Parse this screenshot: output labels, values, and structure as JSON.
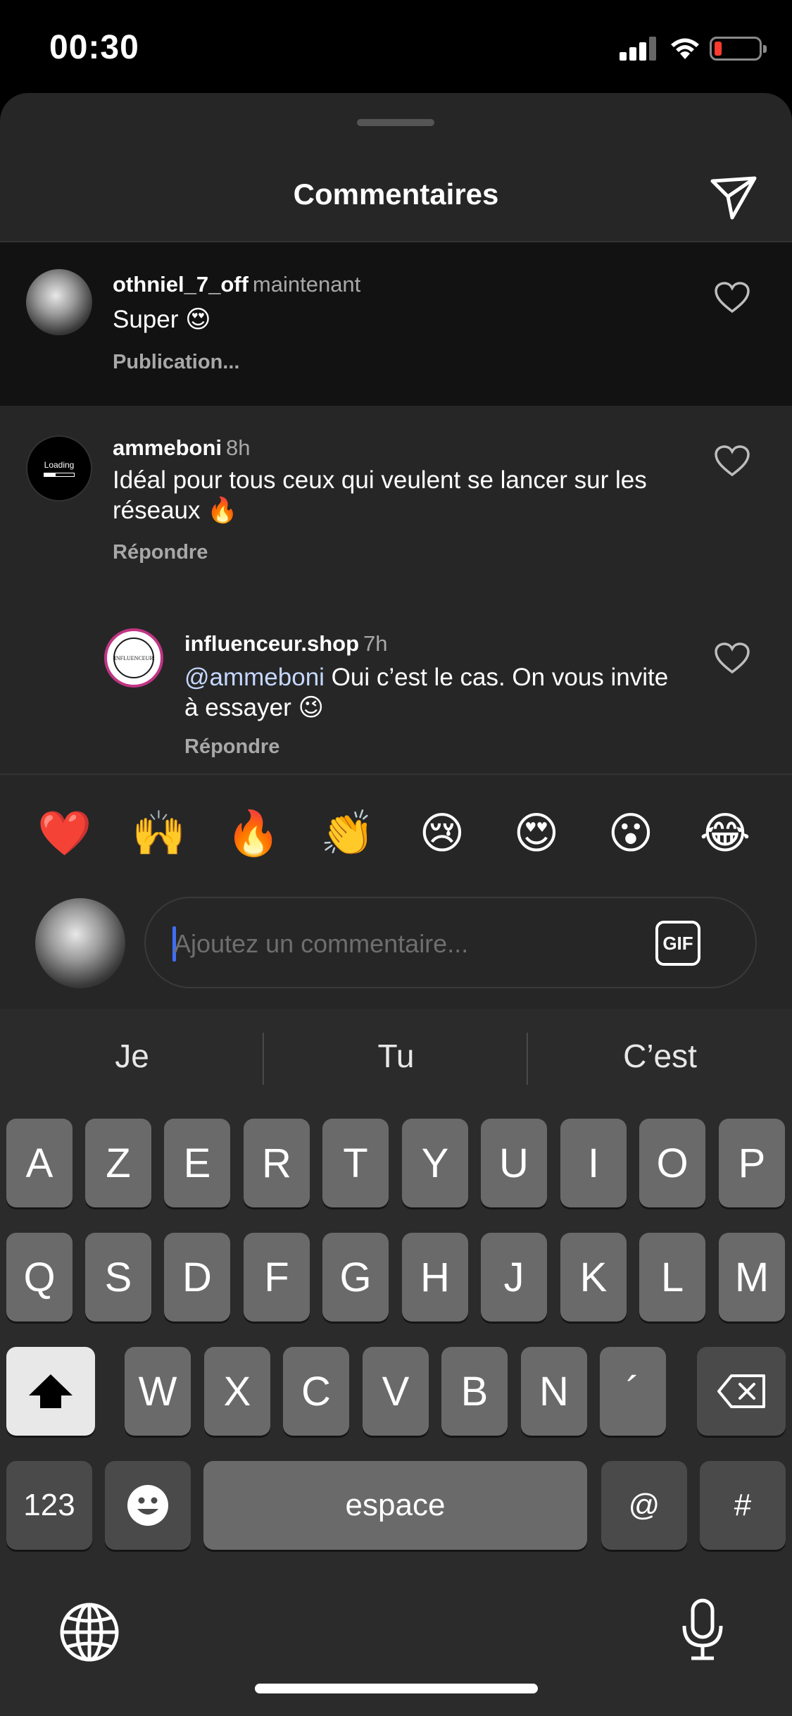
{
  "status_bar": {
    "time": "00:30"
  },
  "sheet": {
    "title": "Commentaires"
  },
  "comments": [
    {
      "user": "othniel_7_off",
      "time": "maintenant",
      "text": "Super 😍",
      "status": "Publication..."
    },
    {
      "user": "ammeboni",
      "time": "8h",
      "text": "Idéal pour tous ceux qui veulent se lancer sur les réseaux 🔥",
      "action": "Répondre",
      "avatar_text": "Loading"
    },
    {
      "user": "influenceur.shop",
      "time": "7h",
      "mention": "@ammeboni",
      "text": " Oui c’est le cas. On vous invite à essayer 😉",
      "action": "Répondre",
      "avatar_text": "INFLUENCEUR"
    }
  ],
  "emoji_bar": [
    "❤️",
    "🙌",
    "🔥",
    "👏",
    "😢",
    "😍",
    "😮",
    "😂"
  ],
  "composer": {
    "placeholder": "Ajoutez un commentaire...",
    "gif_label": "GIF"
  },
  "keyboard": {
    "suggestions": [
      "Je",
      "Tu",
      "C’est"
    ],
    "row1": [
      "A",
      "Z",
      "E",
      "R",
      "T",
      "Y",
      "U",
      "I",
      "O",
      "P"
    ],
    "row2": [
      "Q",
      "S",
      "D",
      "F",
      "G",
      "H",
      "J",
      "K",
      "L",
      "M"
    ],
    "row3": [
      "W",
      "X",
      "C",
      "V",
      "B",
      "N",
      "´"
    ],
    "numbers_label": "123",
    "space_label": "espace",
    "at_label": "@",
    "hash_label": "#"
  },
  "colors": {
    "accent": "#3f6df3",
    "battery_low": "#ff3b30",
    "sheet_bg": "#262626"
  }
}
